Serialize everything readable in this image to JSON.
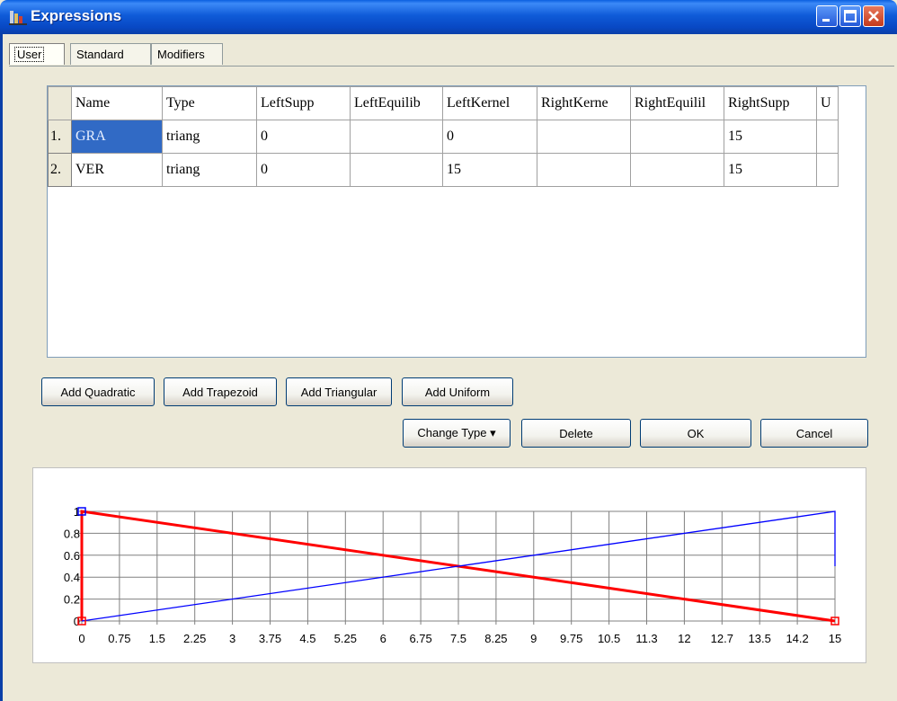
{
  "window": {
    "title": "Expressions"
  },
  "tabs": [
    {
      "label": "User",
      "active": true
    },
    {
      "label": "Standard",
      "active": false
    },
    {
      "label": "Modifiers",
      "active": false
    }
  ],
  "grid": {
    "columns": [
      "Name",
      "Type",
      "LeftSupp",
      "LeftEquilib",
      "LeftKernel",
      "RightKerne",
      "RightEquilil",
      "RightSupp",
      "U"
    ],
    "rows": [
      {
        "num": "1.",
        "cells": [
          "GRA",
          "triang",
          "0",
          "",
          "0",
          "",
          "",
          "15",
          ""
        ]
      },
      {
        "num": "2.",
        "cells": [
          "VER",
          "triang",
          "0",
          "",
          "15",
          "",
          "",
          "15",
          ""
        ]
      }
    ]
  },
  "buttons": {
    "add_quadratic": "Add Quadratic",
    "add_trapezoid": "Add Trapezoid",
    "add_triangular": "Add Triangular",
    "add_uniform": "Add Uniform",
    "change_type": "Change Type ▾",
    "delete": "Delete",
    "ok": "OK",
    "cancel": "Cancel"
  },
  "chart_data": {
    "type": "line",
    "x_tick_labels": [
      "0",
      "0.75",
      "1.5",
      "2.25",
      "3",
      "3.75",
      "4.5",
      "5.25",
      "6",
      "6.75",
      "7.5",
      "8.25",
      "9",
      "9.75",
      "10.5",
      "11.3",
      "12",
      "12.7",
      "13.5",
      "14.2",
      "15"
    ],
    "y_tick_labels": [
      "0",
      "0.2",
      "0.4",
      "0.6",
      "0.8",
      "1"
    ],
    "xlim": [
      0,
      15
    ],
    "ylim": [
      0,
      1
    ],
    "grid": true,
    "series": [
      {
        "name": "GRA",
        "color": "#ff0000",
        "points": [
          [
            0,
            0
          ],
          [
            0,
            1
          ],
          [
            15,
            0
          ]
        ]
      },
      {
        "name": "VER",
        "color": "#0000ff",
        "points": [
          [
            0,
            0
          ],
          [
            15,
            1
          ],
          [
            15,
            0.5
          ]
        ]
      }
    ]
  }
}
